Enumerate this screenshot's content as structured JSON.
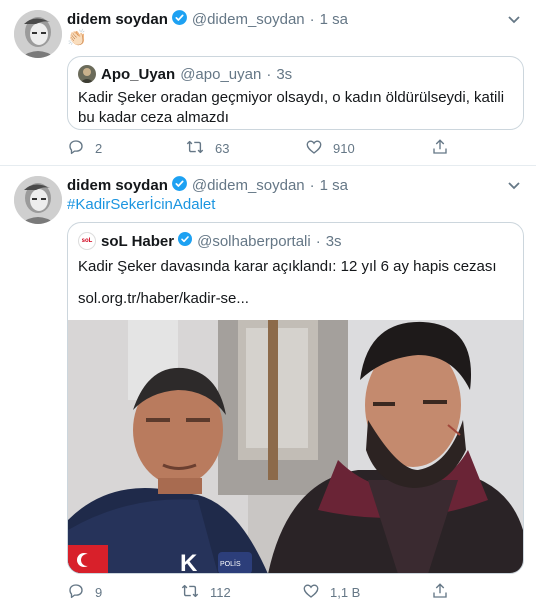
{
  "tweets": [
    {
      "name": "didem soydan",
      "handle": "@didem_soydan",
      "dot": "·",
      "time": "1 sa",
      "text": "👏🏻",
      "quote": {
        "name": "Apo_Uyan",
        "handle": "@apo_uyan",
        "dot": "·",
        "time": "3s",
        "text": "Kadir Şeker oradan geçmiyor olsaydı, o kadın öldürülseydi, katili bu kadar ceza almazdı"
      },
      "actions": {
        "replies": "2",
        "retweets": "63",
        "likes": "910"
      }
    },
    {
      "name": "didem soydan",
      "handle": "@didem_soydan",
      "dot": "·",
      "time": "1 sa",
      "text": "#KadirSekerİcinAdalet",
      "quote": {
        "avatar_text": "soL",
        "name": "soL Haber",
        "handle": "@solhaberportali",
        "dot": "·",
        "time": "3s",
        "text": "Kadir Şeker davasında karar açıklandı: 12 yıl 6 ay hapis cezası",
        "link": "sol.org.tr/haber/kadir-se...",
        "image_badge": "K",
        "image_patch": "POLİS"
      },
      "actions": {
        "replies": "9",
        "retweets": "112",
        "likes": "1,1 B"
      }
    }
  ],
  "icons": {
    "verified": "verified-badge-icon",
    "caret": "chevron-down-icon",
    "reply": "reply-icon",
    "retweet": "retweet-icon",
    "like": "heart-icon",
    "share": "share-icon"
  },
  "colors": {
    "accent": "#1da1f2",
    "link": "#1b95e0",
    "muted": "#657786",
    "border": "#ccd6dd"
  }
}
